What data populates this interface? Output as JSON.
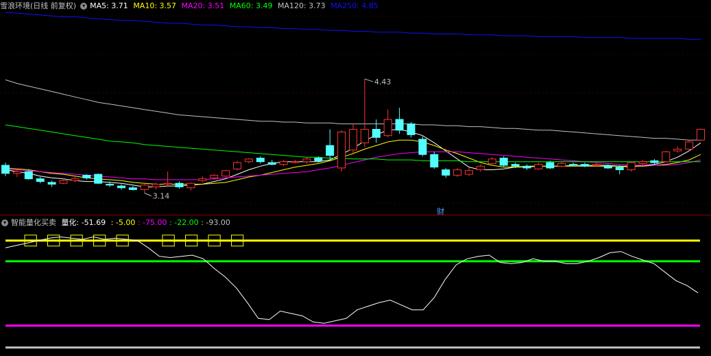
{
  "header": {
    "title": "雪浪环境(日线 前复权)",
    "ma": [
      {
        "label": "MA5: 3.71",
        "color": "#ffffff"
      },
      {
        "label": "MA10: 3.57",
        "color": "#ffff00"
      },
      {
        "label": "MA20: 3.51",
        "color": "#ff00ff"
      },
      {
        "label": "MA60: 3.49",
        "color": "#00ff00"
      },
      {
        "label": "MA120: 3.73",
        "color": "#c0c0c0"
      },
      {
        "label": "MA250: 4.85",
        "color": "#1010ff"
      }
    ]
  },
  "indicator": {
    "title": "智能量化买卖",
    "parts": [
      {
        "label": "量化: -51.69",
        "color": "#ffffff"
      },
      {
        "label": ": -5.00",
        "color": "#ffff00"
      },
      {
        "label": ": -75.00",
        "color": "#ff00ff"
      },
      {
        "label": ": -22.00",
        "color": "#00ff00"
      },
      {
        "label": ": -93.00",
        "color": "#c0c0c0"
      }
    ]
  },
  "annotations": {
    "high": "4.43",
    "low": "3.14",
    "event": "财"
  },
  "chart_data": [
    {
      "type": "candlestick",
      "ylim": [
        3.0,
        5.15
      ],
      "candles": [
        [
          3.45,
          3.36,
          3.48,
          3.33
        ],
        [
          3.36,
          3.38,
          3.41,
          3.32
        ],
        [
          3.38,
          3.3,
          3.4,
          3.29
        ],
        [
          3.3,
          3.27,
          3.32,
          3.25
        ],
        [
          3.26,
          3.24,
          3.28,
          3.21
        ],
        [
          3.25,
          3.28,
          3.3,
          3.24
        ],
        [
          3.28,
          3.3,
          3.33,
          3.26
        ],
        [
          3.34,
          3.31,
          3.35,
          3.29
        ],
        [
          3.35,
          3.25,
          3.36,
          3.24
        ],
        [
          3.24,
          3.23,
          3.27,
          3.21
        ],
        [
          3.22,
          3.2,
          3.24,
          3.18
        ],
        [
          3.2,
          3.18,
          3.22,
          3.17
        ],
        [
          3.18,
          3.23,
          3.25,
          3.14
        ],
        [
          3.21,
          3.24,
          3.26,
          3.18
        ],
        [
          3.24,
          3.25,
          3.38,
          3.21
        ],
        [
          3.25,
          3.21,
          3.27,
          3.19
        ],
        [
          3.2,
          3.25,
          3.26,
          3.17
        ],
        [
          3.28,
          3.3,
          3.33,
          3.26
        ],
        [
          3.31,
          3.34,
          3.35,
          3.29
        ],
        [
          3.33,
          3.39,
          3.4,
          3.32
        ],
        [
          3.41,
          3.48,
          3.5,
          3.39
        ],
        [
          3.49,
          3.52,
          3.53,
          3.47
        ],
        [
          3.53,
          3.49,
          3.55,
          3.47
        ],
        [
          3.48,
          3.46,
          3.51,
          3.45
        ],
        [
          3.46,
          3.49,
          3.51,
          3.44
        ],
        [
          3.48,
          3.49,
          3.51,
          3.47
        ],
        [
          3.49,
          3.52,
          3.54,
          3.47
        ],
        [
          3.53,
          3.5,
          3.55,
          3.48
        ],
        [
          3.67,
          3.56,
          3.85,
          3.5
        ],
        [
          3.42,
          3.82,
          3.84,
          3.38
        ],
        [
          3.62,
          3.85,
          3.91,
          3.58
        ],
        [
          3.7,
          3.85,
          4.41,
          3.65
        ],
        [
          3.85,
          3.76,
          3.96,
          3.7
        ],
        [
          3.78,
          3.96,
          4.07,
          3.76
        ],
        [
          3.96,
          3.84,
          4.09,
          3.8
        ],
        [
          3.91,
          3.79,
          3.93,
          3.76
        ],
        [
          3.74,
          3.57,
          3.77,
          3.55
        ],
        [
          3.57,
          3.43,
          3.6,
          3.41
        ],
        [
          3.4,
          3.34,
          3.42,
          3.31
        ],
        [
          3.34,
          3.4,
          3.42,
          3.32
        ],
        [
          3.35,
          3.39,
          3.42,
          3.33
        ],
        [
          3.4,
          3.44,
          3.46,
          3.38
        ],
        [
          3.47,
          3.52,
          3.54,
          3.45
        ],
        [
          3.53,
          3.45,
          3.55,
          3.43
        ],
        [
          3.46,
          3.44,
          3.48,
          3.42
        ],
        [
          3.44,
          3.42,
          3.46,
          3.4
        ],
        [
          3.41,
          3.46,
          3.48,
          3.4
        ],
        [
          3.48,
          3.42,
          3.5,
          3.41
        ],
        [
          3.44,
          3.47,
          3.49,
          3.43
        ],
        [
          3.46,
          3.45,
          3.48,
          3.44
        ],
        [
          3.46,
          3.44,
          3.48,
          3.43
        ],
        [
          3.45,
          3.46,
          3.48,
          3.44
        ],
        [
          3.44,
          3.42,
          3.46,
          3.41
        ],
        [
          3.43,
          3.4,
          3.45,
          3.35
        ],
        [
          3.4,
          3.48,
          3.49,
          3.38
        ],
        [
          3.47,
          3.49,
          3.51,
          3.45
        ],
        [
          3.5,
          3.48,
          3.52,
          3.46
        ],
        [
          3.49,
          3.6,
          3.61,
          3.48
        ],
        [
          3.61,
          3.63,
          3.66,
          3.59
        ],
        [
          3.63,
          3.71,
          3.73,
          3.62
        ],
        [
          3.73,
          3.85,
          3.86,
          3.72
        ]
      ],
      "ma_lines": [
        {
          "name": "MA5",
          "color": "#ffffff",
          "values": [
            3.4,
            3.38,
            3.36,
            3.33,
            3.31,
            3.3,
            3.28,
            3.27,
            3.27,
            3.26,
            3.25,
            3.23,
            3.21,
            3.21,
            3.22,
            3.22,
            3.23,
            3.24,
            3.27,
            3.3,
            3.35,
            3.4,
            3.44,
            3.47,
            3.49,
            3.49,
            3.49,
            3.49,
            3.51,
            3.57,
            3.64,
            3.72,
            3.79,
            3.84,
            3.85,
            3.82,
            3.78,
            3.7,
            3.61,
            3.52,
            3.43,
            3.4,
            3.4,
            3.41,
            3.43,
            3.44,
            3.44,
            3.44,
            3.44,
            3.45,
            3.45,
            3.45,
            3.45,
            3.44,
            3.43,
            3.45,
            3.46,
            3.49,
            3.54,
            3.61,
            3.7
          ]
        },
        {
          "name": "MA10",
          "color": "#ffff00",
          "values": [
            3.42,
            3.41,
            3.4,
            3.38,
            3.36,
            3.35,
            3.33,
            3.31,
            3.3,
            3.29,
            3.28,
            3.26,
            3.25,
            3.24,
            3.24,
            3.24,
            3.24,
            3.24,
            3.25,
            3.26,
            3.29,
            3.32,
            3.34,
            3.37,
            3.4,
            3.43,
            3.45,
            3.47,
            3.5,
            3.54,
            3.58,
            3.63,
            3.67,
            3.71,
            3.73,
            3.73,
            3.71,
            3.67,
            3.62,
            3.58,
            3.53,
            3.48,
            3.45,
            3.43,
            3.43,
            3.43,
            3.44,
            3.44,
            3.44,
            3.44,
            3.44,
            3.44,
            3.44,
            3.44,
            3.44,
            3.44,
            3.45,
            3.46,
            3.48,
            3.51,
            3.57
          ]
        },
        {
          "name": "MA20",
          "color": "#ff00ff",
          "values": [
            3.4,
            3.4,
            3.39,
            3.38,
            3.37,
            3.36,
            3.35,
            3.34,
            3.33,
            3.32,
            3.31,
            3.3,
            3.3,
            3.29,
            3.29,
            3.29,
            3.29,
            3.29,
            3.3,
            3.31,
            3.32,
            3.33,
            3.34,
            3.35,
            3.36,
            3.37,
            3.38,
            3.4,
            3.42,
            3.45,
            3.48,
            3.51,
            3.54,
            3.56,
            3.58,
            3.59,
            3.6,
            3.6,
            3.6,
            3.6,
            3.59,
            3.58,
            3.57,
            3.56,
            3.55,
            3.54,
            3.53,
            3.52,
            3.51,
            3.5,
            3.49,
            3.48,
            3.47,
            3.46,
            3.45,
            3.45,
            3.45,
            3.45,
            3.46,
            3.48,
            3.51
          ]
        },
        {
          "name": "MA60",
          "color": "#00ff00",
          "values": [
            3.9,
            3.88,
            3.86,
            3.84,
            3.82,
            3.8,
            3.78,
            3.76,
            3.74,
            3.72,
            3.71,
            3.7,
            3.68,
            3.67,
            3.66,
            3.65,
            3.64,
            3.63,
            3.62,
            3.61,
            3.6,
            3.59,
            3.58,
            3.57,
            3.56,
            3.55,
            3.54,
            3.54,
            3.53,
            3.53,
            3.52,
            3.52,
            3.52,
            3.51,
            3.51,
            3.51,
            3.5,
            3.5,
            3.5,
            3.5,
            3.49,
            3.49,
            3.49,
            3.49,
            3.49,
            3.49,
            3.49,
            3.49,
            3.49,
            3.49,
            3.49,
            3.49,
            3.49,
            3.49,
            3.49,
            3.49,
            3.49,
            3.49,
            3.49,
            3.49,
            3.49
          ]
        },
        {
          "name": "MA120",
          "color": "#c0c0c0",
          "values": [
            4.4,
            4.36,
            4.33,
            4.3,
            4.27,
            4.24,
            4.21,
            4.18,
            4.15,
            4.13,
            4.11,
            4.09,
            4.07,
            4.05,
            4.03,
            4.01,
            4.0,
            3.99,
            3.98,
            3.97,
            3.96,
            3.95,
            3.94,
            3.94,
            3.93,
            3.93,
            3.92,
            3.92,
            3.92,
            3.91,
            3.91,
            3.91,
            3.91,
            3.91,
            3.91,
            3.91,
            3.9,
            3.9,
            3.89,
            3.89,
            3.88,
            3.88,
            3.87,
            3.86,
            3.86,
            3.85,
            3.84,
            3.84,
            3.83,
            3.82,
            3.81,
            3.8,
            3.79,
            3.78,
            3.77,
            3.76,
            3.75,
            3.75,
            3.74,
            3.73,
            3.73
          ]
        },
        {
          "name": "MA250",
          "color": "#1010ff",
          "values": [
            5.15,
            5.14,
            5.13,
            5.12,
            5.11,
            5.1,
            5.1,
            5.09,
            5.08,
            5.07,
            5.06,
            5.06,
            5.05,
            5.04,
            5.03,
            5.03,
            5.02,
            5.01,
            5.01,
            5.0,
            4.99,
            4.99,
            4.98,
            4.98,
            4.97,
            4.97,
            4.96,
            4.96,
            4.95,
            4.95,
            4.94,
            4.94,
            4.93,
            4.93,
            4.93,
            4.92,
            4.92,
            4.91,
            4.91,
            4.91,
            4.9,
            4.9,
            4.9,
            4.89,
            4.89,
            4.89,
            4.88,
            4.88,
            4.88,
            4.88,
            4.87,
            4.87,
            4.87,
            4.87,
            4.86,
            4.86,
            4.86,
            4.86,
            4.86,
            4.85,
            4.85
          ]
        }
      ]
    },
    {
      "type": "line",
      "ylim": [
        -100,
        5
      ],
      "hlines": [
        {
          "value": -5,
          "color": "#ffff00"
        },
        {
          "value": -22,
          "color": "#00ff00"
        },
        {
          "value": -75,
          "color": "#ff00ff"
        },
        {
          "value": -93,
          "color": "#c0c0c0"
        }
      ],
      "series": [
        {
          "name": "量化",
          "color": "#ffffff",
          "values": [
            -11,
            -9,
            -7,
            -5,
            -3,
            -2,
            -3,
            -4,
            -2,
            -4,
            -3,
            -4,
            -5,
            -11,
            -18,
            -19,
            -18,
            -17,
            -20,
            -28,
            -35,
            -44,
            -56,
            -69,
            -70,
            -63,
            -65,
            -67,
            -72,
            -73,
            -71,
            -69,
            -62,
            -59,
            -56,
            -54,
            -58,
            -62,
            -62,
            -52,
            -37,
            -25,
            -20,
            -18,
            -17,
            -23,
            -24,
            -23,
            -20,
            -22,
            -22,
            -24,
            -24,
            -22,
            -19,
            -15,
            -14,
            -18,
            -21,
            -24,
            -31,
            -38,
            -42,
            -48
          ]
        }
      ],
      "box_marks": {
        "count": 10,
        "value": -5
      }
    }
  ]
}
